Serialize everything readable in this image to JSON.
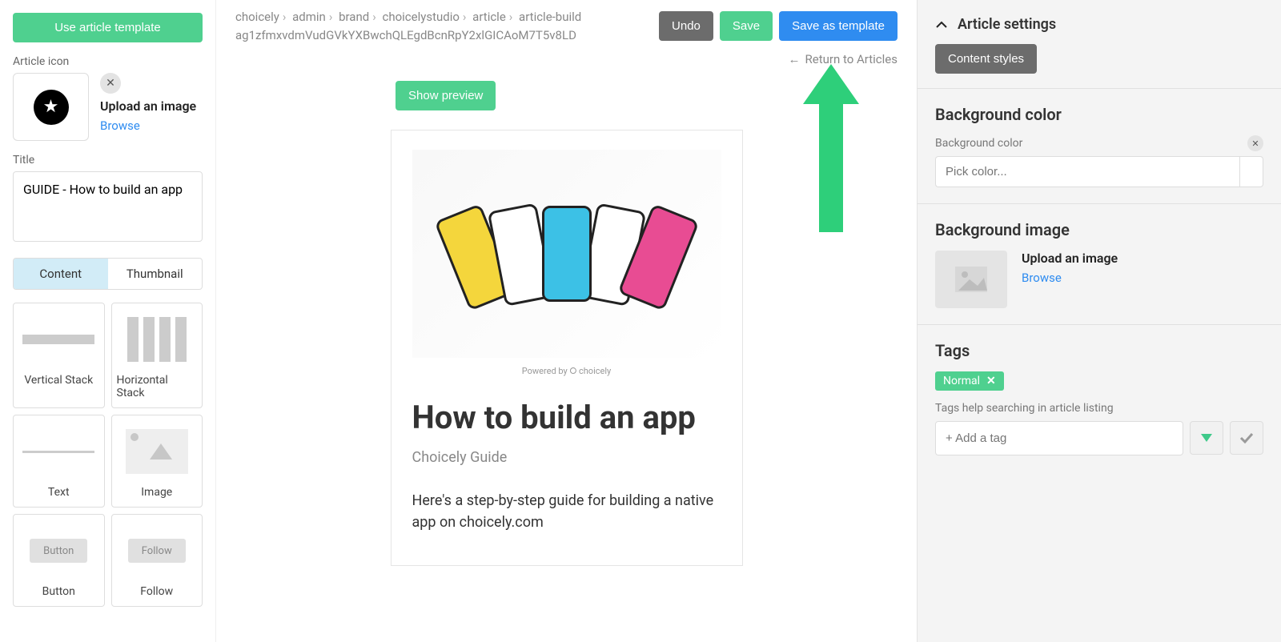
{
  "left": {
    "use_template": "Use article template",
    "article_icon_label": "Article icon",
    "upload_image": "Upload an image",
    "browse": "Browse",
    "title_label": "Title",
    "title_value": "GUIDE - How to build an app",
    "tabs": {
      "content": "Content",
      "thumbnail": "Thumbnail"
    },
    "blocks": {
      "vstack": "Vertical Stack",
      "hstack": "Horizontal Stack",
      "text": "Text",
      "image": "Image",
      "button": "Button",
      "follow": "Follow",
      "button_ic": "Button",
      "follow_ic": "Follow"
    }
  },
  "center": {
    "breadcrumbs": [
      "choicely",
      "admin",
      "brand",
      "choicelystudio",
      "article",
      "article-build"
    ],
    "slug": "ag1zfmxvdmVudGVkYXBwchQLEgdBcnRpY2xlGICAoM7T5v8LD",
    "undo": "Undo",
    "save": "Save",
    "save_template": "Save as template",
    "return": "Return to Articles",
    "show_preview": "Show preview",
    "powered": "Powered by ⭘ choicely",
    "article": {
      "title": "How to build an app",
      "subtitle": "Choicely Guide",
      "body": "Here's a step-by-step guide for building a native app on choicely.com"
    }
  },
  "right": {
    "header": "Article settings",
    "content_styles": "Content styles",
    "bgcolor_title": "Background color",
    "bgcolor_label": "Background color",
    "pick_color": "Pick color...",
    "bgimage_title": "Background image",
    "upload_image": "Upload an image",
    "browse": "Browse",
    "tags_title": "Tags",
    "tag_normal": "Normal",
    "tags_help": "Tags help searching in article listing",
    "add_tag": "+ Add a tag"
  }
}
